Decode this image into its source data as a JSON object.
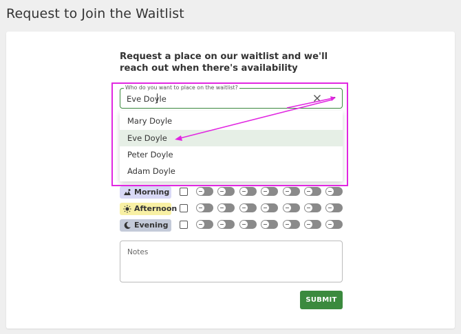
{
  "page": {
    "title": "Request to Join the Waitlist"
  },
  "form": {
    "heading": "Request a place on our waitlist and we'll reach out when there's availability",
    "who": {
      "label": "Who do you want to place on the waitlist?",
      "value": "Eve Doyle",
      "clear_icon": "close-icon",
      "dropdown_icon": "chevron-down-icon",
      "options": [
        "Mary Doyle",
        "Eve Doyle",
        "Peter Doyle",
        "Adam Doyle"
      ],
      "selected": "Eve Doyle"
    },
    "time_slots": [
      {
        "label": "Morning",
        "icon": "sunrise-icon",
        "color": "#d9d9f6"
      },
      {
        "label": "Afternoon",
        "icon": "sun-icon",
        "color": "#f8f0a4"
      },
      {
        "label": "Evening",
        "icon": "moon-icon",
        "color": "#c4cad9"
      }
    ],
    "notes": {
      "placeholder": "Notes"
    },
    "submit_label": "SUBMIT"
  },
  "colors": {
    "accent": "#3b8a3e",
    "annotation": "#e126e1",
    "toggle_off": "#8a8a8a",
    "selected_option": "#e6efe6"
  }
}
